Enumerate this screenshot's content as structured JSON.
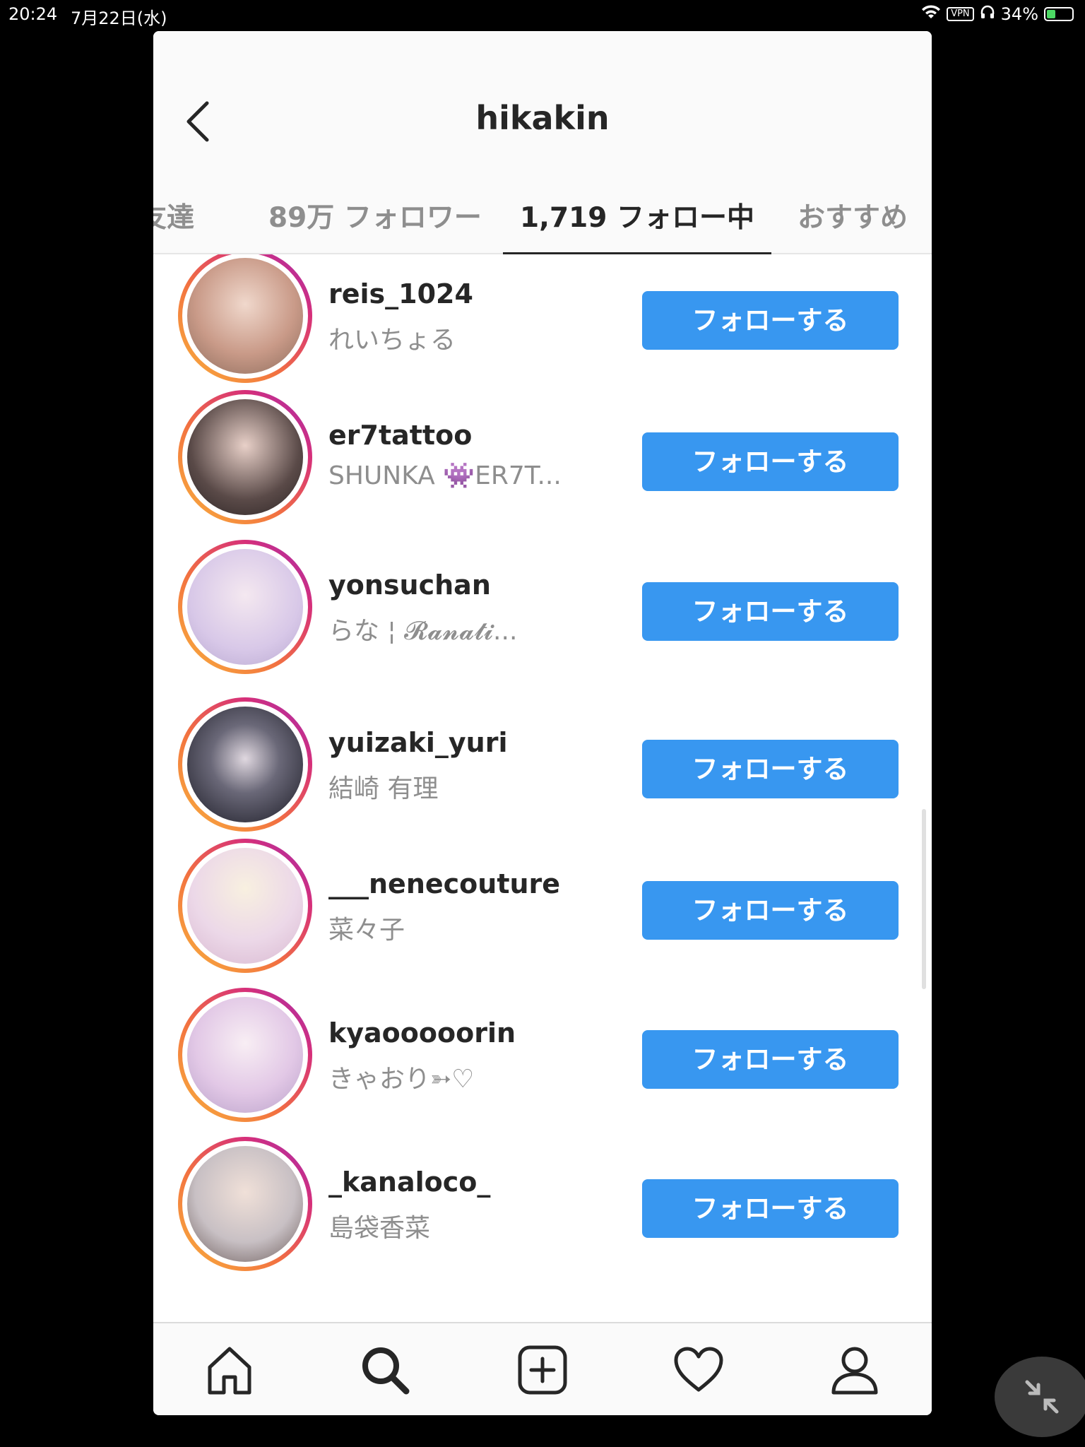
{
  "status_bar": {
    "time": "20:24",
    "date": "7月22日(水)",
    "vpn": "VPN",
    "battery": "34%",
    "battery_level": 0.34
  },
  "header": {
    "title": "hikakin",
    "back_icon": "chevron-left-icon"
  },
  "tabs": [
    {
      "label": "友達"
    },
    {
      "label": "89万 フォロワー"
    },
    {
      "label": "1,719 フォロー中",
      "active": true
    },
    {
      "label": "おすすめ"
    }
  ],
  "users": [
    {
      "username": "reis_1024",
      "fullname": "れいちょる",
      "button": "フォローする",
      "avatar_color": "#c99a88"
    },
    {
      "username": "er7tattoo",
      "fullname": "SHUNKA 👾ER7T...",
      "button": "フォローする",
      "avatar_color": "#5a4a48"
    },
    {
      "username": "yonsuchan",
      "fullname": "らな ¦ 𝓡𝓪𝓷𝓪𝓽𝓲...",
      "button": "フォローする",
      "avatar_color": "#d8c8e8"
    },
    {
      "username": "yuizaki_yuri",
      "fullname": "結崎 有理",
      "button": "フォローする",
      "avatar_color": "#2a2a3a"
    },
    {
      "username": "___nenecouture",
      "fullname": "菜々子",
      "button": "フォローする",
      "avatar_color": "#ecd8e8"
    },
    {
      "username": "kyaooooorin",
      "fullname": "きゃおり➳♡",
      "button": "フォローする",
      "avatar_color": "#e2c8e6"
    },
    {
      "username": "_kanaloco_",
      "fullname": "島袋香菜",
      "button": "フォローする",
      "avatar_color": "#c8c0c4"
    }
  ],
  "nav": [
    {
      "icon": "home-icon"
    },
    {
      "icon": "search-icon",
      "active": true
    },
    {
      "icon": "add-post-icon"
    },
    {
      "icon": "heart-icon"
    },
    {
      "icon": "profile-icon"
    }
  ],
  "float_button": {
    "icon": "collapse-icon"
  }
}
